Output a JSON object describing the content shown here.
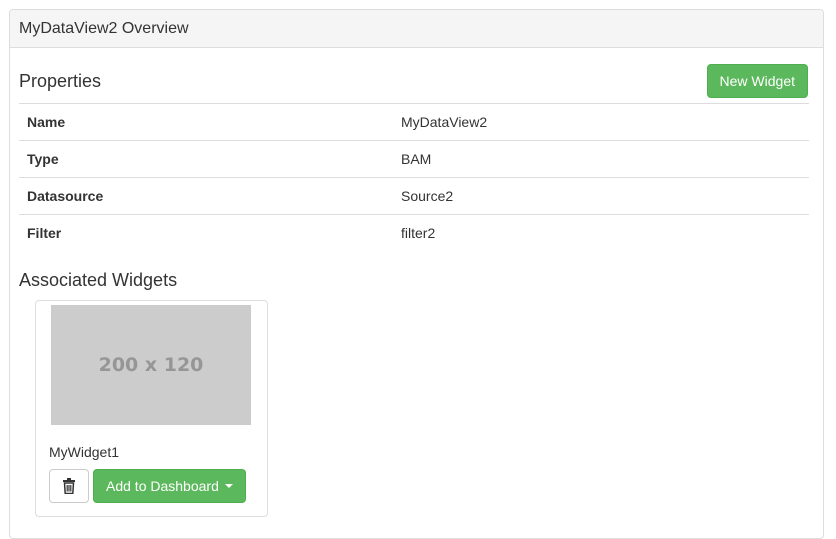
{
  "panel": {
    "title": "MyDataView2 Overview"
  },
  "properties": {
    "heading": "Properties",
    "new_widget_label": "New Widget",
    "rows": [
      {
        "key": "Name",
        "value": "MyDataView2"
      },
      {
        "key": "Type",
        "value": "BAM"
      },
      {
        "key": "Datasource",
        "value": "Source2"
      },
      {
        "key": "Filter",
        "value": "filter2"
      }
    ]
  },
  "widgets": {
    "heading": "Associated Widgets",
    "items": [
      {
        "placeholder_text": "200 x 120",
        "name": "MyWidget1",
        "delete_icon": "trash-icon",
        "add_label": "Add to Dashboard",
        "add_icon": "caret-down-icon"
      }
    ]
  },
  "colors": {
    "success": "#5cb85c",
    "border": "#dddddd",
    "heading_bg": "#f5f5f5",
    "placeholder_bg": "#cccccc"
  }
}
